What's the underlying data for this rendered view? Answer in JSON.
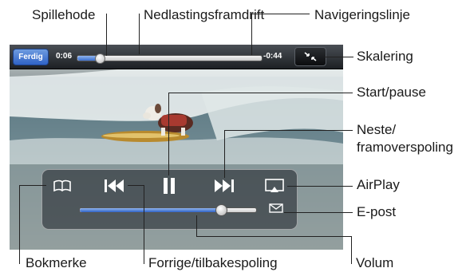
{
  "callouts": {
    "scrubber": "Spillehode",
    "download_progress": "Nedlastingsframdrift",
    "navigation_bar": "Navigeringslinje",
    "scale": "Skalering",
    "play_pause": "Start/pause",
    "next_line1": "Neste/",
    "next_line2": "framoverspoling",
    "airplay": "AirPlay",
    "email": "E-post",
    "bookmark": "Bokmerke",
    "previous": "Forrige/tilbakespoling",
    "volume": "Volum"
  },
  "player": {
    "done_label": "Ferdig",
    "elapsed": "0:06",
    "remaining": "-0:44",
    "playback_fraction": 0.12,
    "volume_fraction": 0.8,
    "accent_color": "#3b6fd0"
  },
  "icons": {
    "scale": "exit-fullscreen-icon",
    "bookmark": "book-icon",
    "previous": "skip-back-icon",
    "play_pause": "pause-icon",
    "next": "skip-forward-icon",
    "airplay": "airplay-icon",
    "email": "envelope-icon"
  }
}
